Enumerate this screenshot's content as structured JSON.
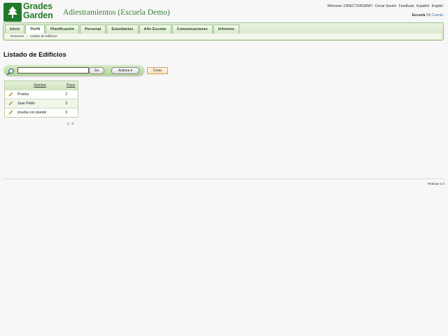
{
  "brand": {
    "line1": "Grades",
    "line2": "Garden",
    "color": "#2a7d2c"
  },
  "app_title": "Adiestramientos (Escuela Demo)",
  "top_links": {
    "welcome": "Welcome: DIRECTORDEMO",
    "logout": "Cerrar Sesión",
    "feedback": "Feedback",
    "espanol": "Español",
    "english": "English"
  },
  "school_links": {
    "escuela": "Escuela",
    "sep": "|",
    "mi_cuenta": "Mi Cuenta"
  },
  "nav": {
    "tabs": [
      {
        "label": "Inicio"
      },
      {
        "label": "Perfil"
      },
      {
        "label": "Planificación"
      },
      {
        "label": "Personal"
      },
      {
        "label": "Estudiantes"
      },
      {
        "label": "Año Escolar"
      },
      {
        "label": "Comunicaciones"
      },
      {
        "label": "Informes"
      }
    ],
    "active_tab": "Perfil"
  },
  "breadcrumb": {
    "root": "Resumen",
    "sep": ">",
    "current": "Listado de Edificios"
  },
  "page_title": "Listado de Edificios",
  "search": {
    "value": "",
    "go_label": "Go",
    "actions_label": "Actions"
  },
  "crear_label": "Crear",
  "table": {
    "columns": [
      "Nombre",
      "Pisos"
    ],
    "rows": [
      {
        "nombre": "Prueba",
        "pisos": "2"
      },
      {
        "nombre": "Juan Pablo",
        "pisos": "3"
      },
      {
        "nombre": "prueba con plantel",
        "pisos": "3"
      }
    ]
  },
  "pager": "1 - 3",
  "release": "Release 3.3",
  "colors": {
    "nav_green": "#d3e6c3",
    "search_green": "#aed590",
    "crear_orange": "#fbe0b8"
  }
}
